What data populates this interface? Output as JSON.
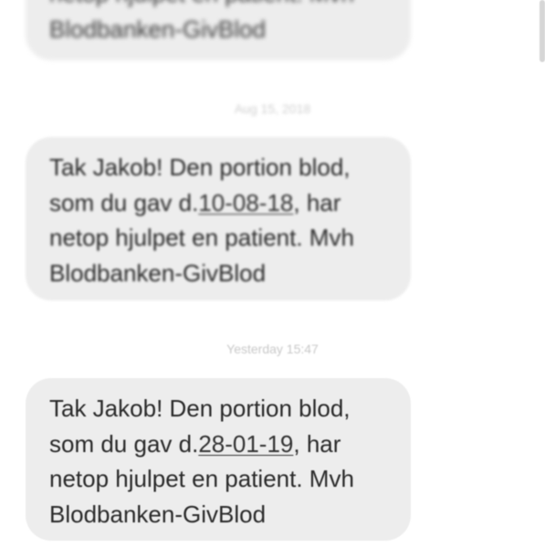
{
  "thread": {
    "messages": [
      {
        "line1": "netop hjulpet en patient. Mvh",
        "line2": "Blodbanken-GivBlod"
      },
      {
        "timestamp": "Aug 15, 2018",
        "pre": "Tak Jakob! Den portion blod,\nsom du gav d.",
        "date_link": "10-08-18",
        "post": ", har\nnetop hjulpet en patient. Mvh\nBlodbanken-GivBlod"
      },
      {
        "timestamp": "Yesterday 15:47",
        "pre": "Tak Jakob! Den portion blod,\nsom du gav d.",
        "date_link": "28-01-19",
        "post": ", har\nnetop hjulpet en patient. Mvh\nBlodbanken-GivBlod"
      }
    ]
  }
}
